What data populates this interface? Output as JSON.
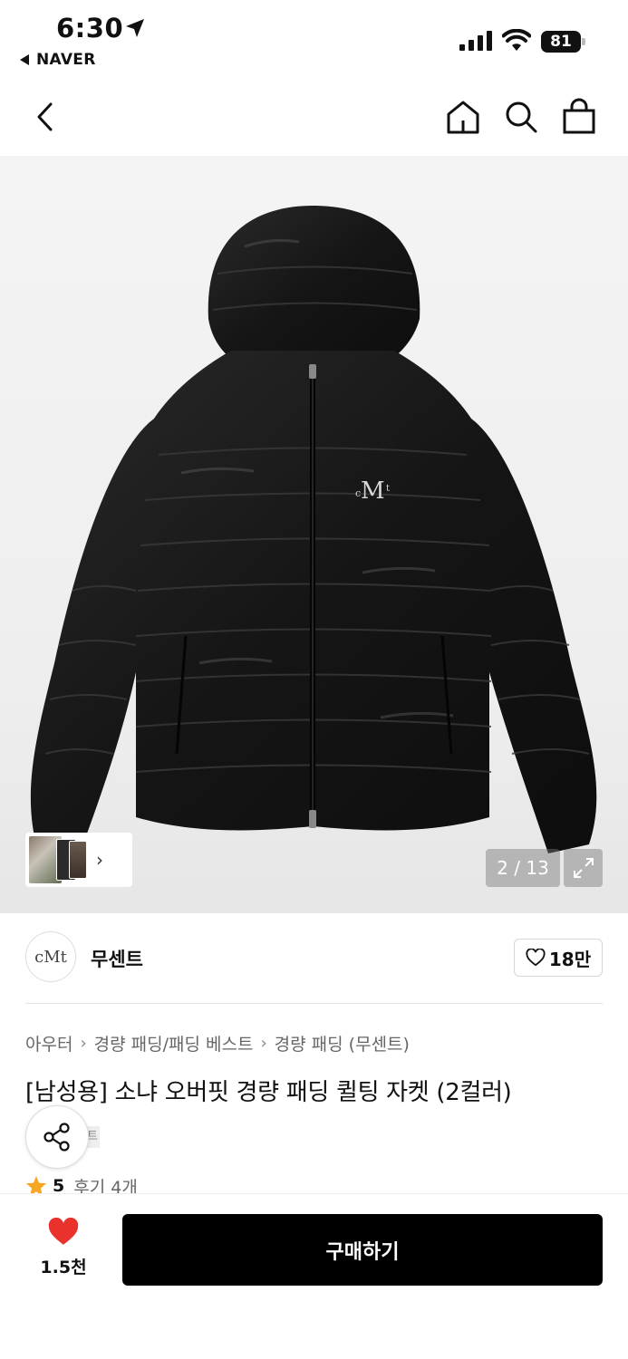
{
  "status_bar": {
    "time": "6:30",
    "back_app": "NAVER",
    "battery": "81"
  },
  "nav": {
    "icons": [
      "back-icon",
      "home-icon",
      "search-icon",
      "shopping-bag-icon"
    ]
  },
  "gallery": {
    "counter": "2 / 13",
    "logo_text": "cMt"
  },
  "store": {
    "logo_text": "cMt",
    "name": "무센트",
    "likes": "18만"
  },
  "breadcrumb": [
    "아우터",
    "경량 패딩/패딩 베스트",
    "경량 패딩 (무센트)"
  ],
  "product": {
    "title": "[남성용] 소냐 오버핏 경량 패딩 퀼팅 자켓 (2컬러)",
    "tag_peek": "트",
    "rating": "5",
    "reviews": "후기 4개"
  },
  "bottom": {
    "wish_count": "1.5천",
    "buy_label": "구매하기"
  },
  "colors": {
    "accent_heart": "#e8322b",
    "star": "#f5a623",
    "buy_button": "#000000"
  }
}
